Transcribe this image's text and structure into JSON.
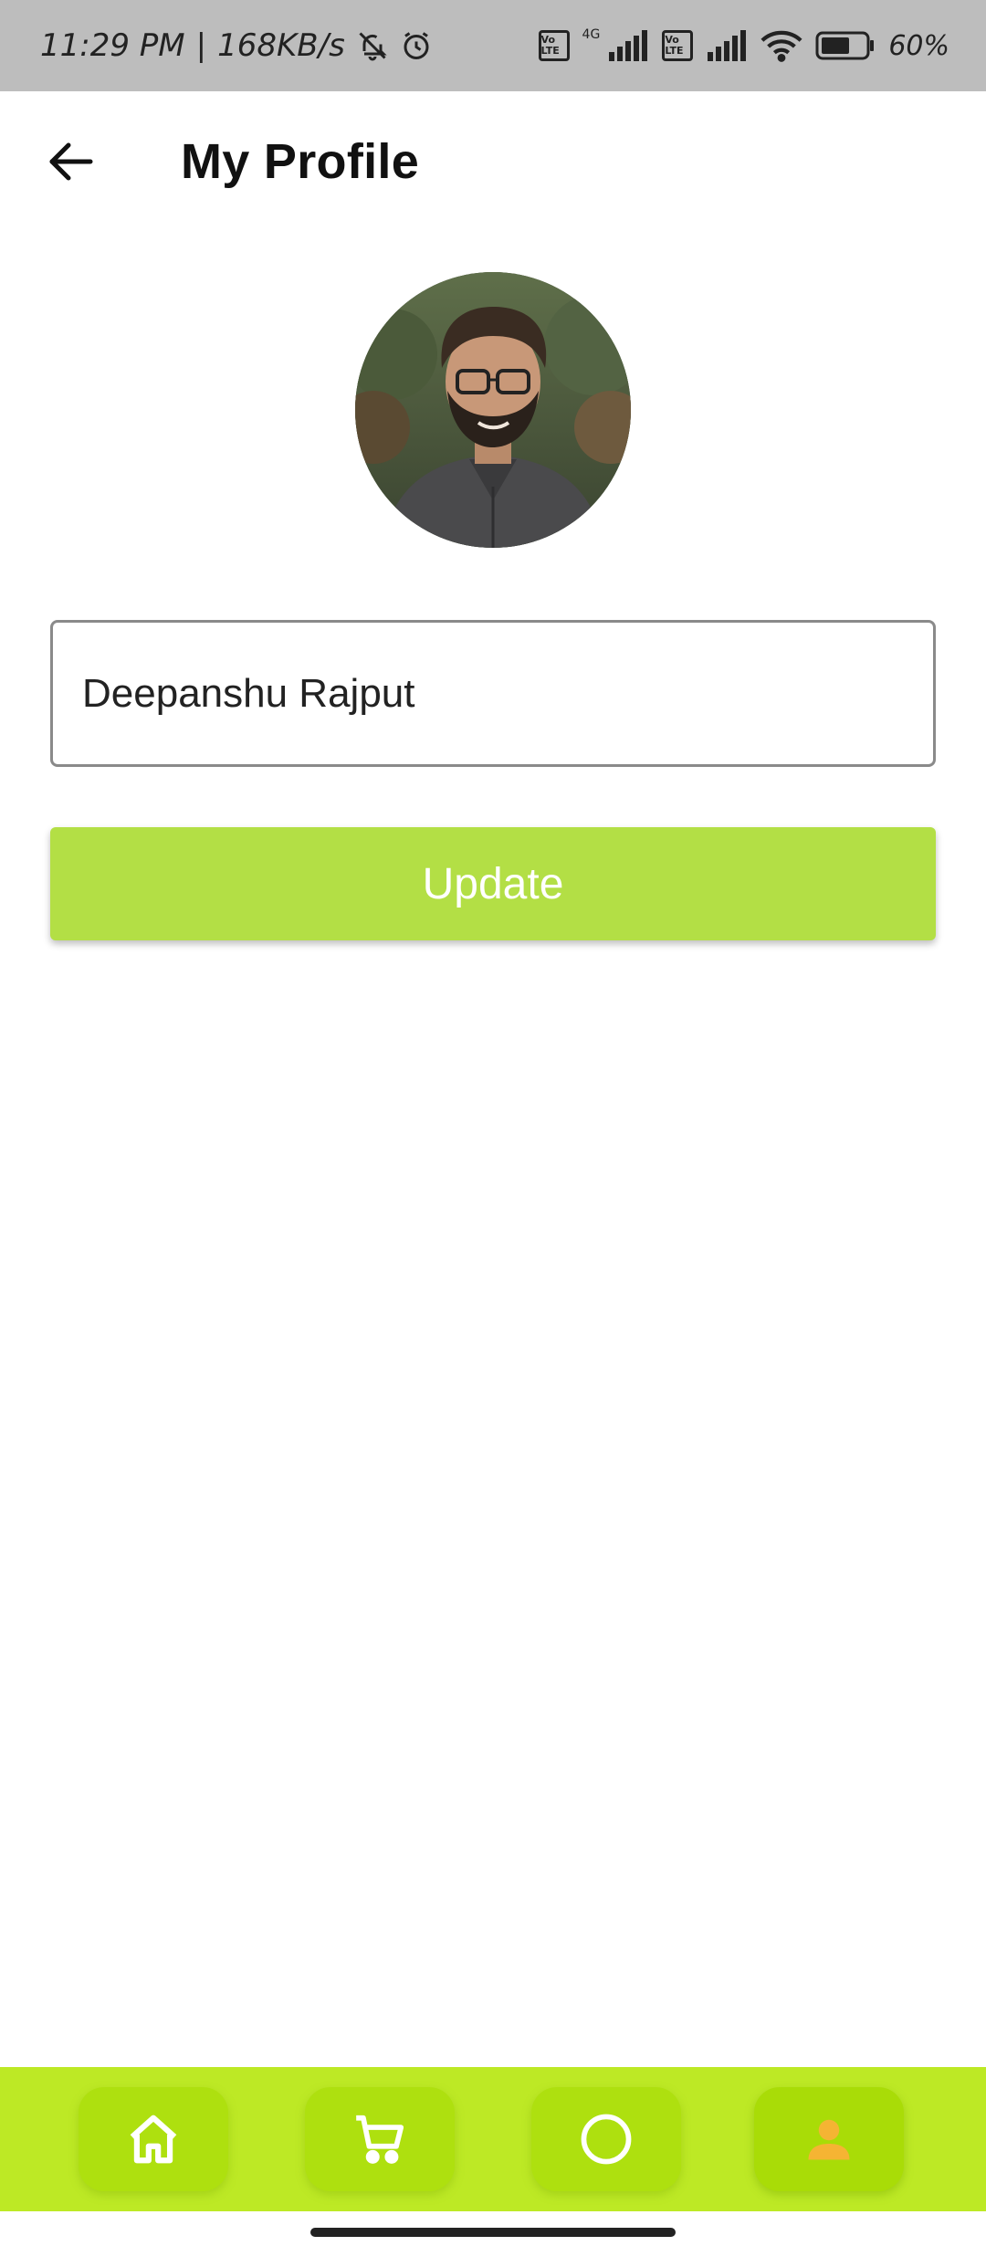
{
  "status_bar": {
    "time": "11:29 PM",
    "separator": "|",
    "speed": "168KB/s",
    "net_gen": "4G",
    "volte_label": "Vo LTE",
    "battery": "60%",
    "icons": [
      "mute-bell-icon",
      "alarm-icon",
      "volte-icon",
      "signal-icon",
      "wifi-icon",
      "battery-icon"
    ]
  },
  "header": {
    "title": "My Profile",
    "back_icon": "arrow-left-icon"
  },
  "profile": {
    "avatar_icon": "profile-photo"
  },
  "form": {
    "name_value": "Deepanshu Rajput",
    "update_label": "Update"
  },
  "bottom_nav": {
    "items": [
      {
        "icon": "home-icon"
      },
      {
        "icon": "cart-icon"
      },
      {
        "icon": "circle-icon"
      },
      {
        "icon": "person-icon",
        "active": true
      }
    ]
  },
  "colors": {
    "accent": "#b3df45",
    "nav_bg": "#bde925",
    "nav_item_bg": "#aee00f",
    "active_icon": "#f5b433"
  }
}
